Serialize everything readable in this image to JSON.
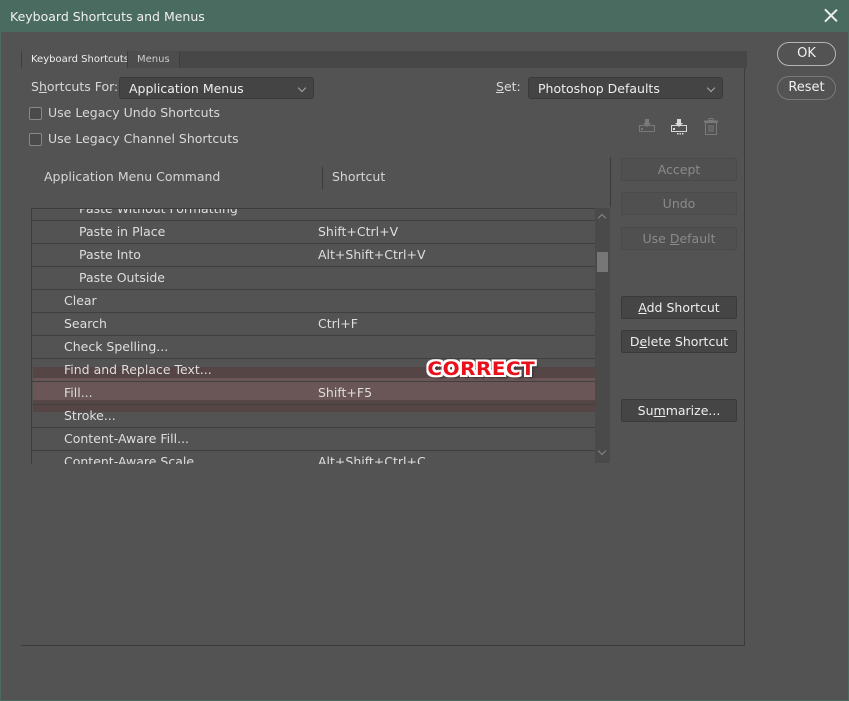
{
  "window": {
    "title": "Keyboard Shortcuts and Menus",
    "close_icon": "close-icon"
  },
  "tabs": [
    {
      "label": "Keyboard Shortcuts",
      "active": true
    },
    {
      "label": "Menus",
      "active": false
    }
  ],
  "shortcuts_for": {
    "label_pre": "S",
    "label_u": "h",
    "label_post": "ortcuts For:",
    "value": "Application Menus"
  },
  "set": {
    "label_u": "S",
    "label_post": "et:",
    "value": "Photoshop Defaults"
  },
  "checkboxes": [
    {
      "label": "Use Legacy Undo Shortcuts",
      "checked": false
    },
    {
      "label": "Use Legacy Channel Shortcuts",
      "checked": false
    }
  ],
  "set_icons": [
    "save-set-icon",
    "save-set-as-icon",
    "delete-set-icon"
  ],
  "table": {
    "headers": {
      "command": "Application Menu Command",
      "shortcut": "Shortcut"
    },
    "rows": [
      {
        "command": "Paste Without Formatting",
        "shortcut": "",
        "indent": 2,
        "partial": true
      },
      {
        "command": "Paste in Place",
        "shortcut": "Shift+Ctrl+V",
        "indent": 2
      },
      {
        "command": "Paste Into",
        "shortcut": "Alt+Shift+Ctrl+V",
        "indent": 2
      },
      {
        "command": "Paste Outside",
        "shortcut": "",
        "indent": 2
      },
      {
        "command": "Clear",
        "shortcut": "",
        "indent": 1
      },
      {
        "command": "Search",
        "shortcut": "Ctrl+F",
        "indent": 1
      },
      {
        "command": "Check Spelling...",
        "shortcut": "",
        "indent": 1
      },
      {
        "command": "Find and Replace Text...",
        "shortcut": "",
        "indent": 1
      },
      {
        "command": "Fill...",
        "shortcut": "Shift+F5",
        "indent": 1,
        "highlighted": true
      },
      {
        "command": "Stroke...",
        "shortcut": "",
        "indent": 1
      },
      {
        "command": "Content-Aware Fill...",
        "shortcut": "",
        "indent": 1
      },
      {
        "command": "Content-Aware Scale",
        "shortcut": "Alt+Shift+Ctrl+C",
        "indent": 1
      }
    ]
  },
  "side_buttons": {
    "accept": "Accept",
    "undo": "Undo",
    "use_default_pre": "Use ",
    "use_default_u": "D",
    "use_default_post": "efault",
    "add_u": "A",
    "add_post": "dd Shortcut",
    "delete_pre": "D",
    "delete_u": "e",
    "delete_post": "lete Shortcut",
    "summarize_pre": "Su",
    "summarize_u": "m",
    "summarize_post": "marize..."
  },
  "dialog_buttons": {
    "ok": "OK",
    "reset": "Reset"
  },
  "overlay": {
    "stamp": "CORRECT"
  },
  "colors": {
    "titlebar": "#4a6b60",
    "background": "#535353",
    "highlight_row": "#6a5656",
    "stamp": "#e8101a"
  }
}
